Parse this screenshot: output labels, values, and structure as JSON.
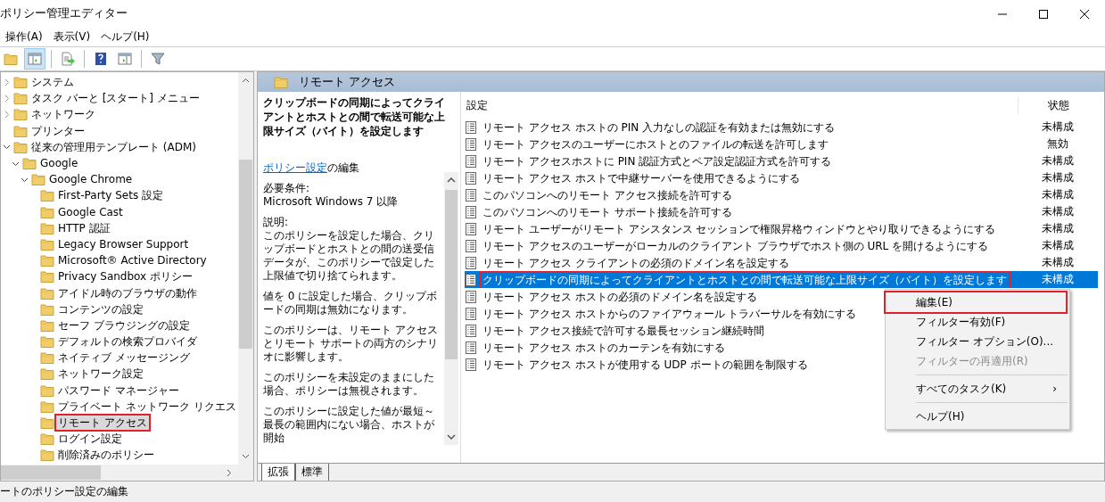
{
  "window": {
    "title": "ポリシー管理エディター"
  },
  "menu": [
    "操作(A)",
    "表示(V)",
    "ヘルプ(H)"
  ],
  "toolbar": [
    {
      "kind": "folder",
      "selected": false
    },
    {
      "kind": "pane",
      "selected": true
    },
    {
      "kind": "sep"
    },
    {
      "kind": "export",
      "selected": false
    },
    {
      "kind": "sep"
    },
    {
      "kind": "help",
      "selected": false
    },
    {
      "kind": "view",
      "selected": false
    },
    {
      "kind": "sep"
    },
    {
      "kind": "filter",
      "selected": false
    }
  ],
  "tree": [
    {
      "label": "システム",
      "expanded": false,
      "selected": false
    },
    {
      "label": "タスク バーと [スタート] メニュー",
      "expanded": false,
      "selected": false
    },
    {
      "label": "ネットワーク",
      "expanded": false,
      "selected": false
    },
    {
      "label": "プリンター",
      "selected": false
    },
    {
      "label": "従来の管理用テンプレート (ADM)",
      "expanded": true,
      "selected": false,
      "children": [
        {
          "label": "Google",
          "expanded": true,
          "selected": false,
          "children": [
            {
              "label": "Google Chrome",
              "expanded": true,
              "selected": false,
              "children": [
                {
                  "label": "First-Party Sets 設定",
                  "selected": false
                },
                {
                  "label": "Google Cast",
                  "selected": false
                },
                {
                  "label": "HTTP 認証",
                  "selected": false
                },
                {
                  "label": "Legacy Browser Support",
                  "selected": false
                },
                {
                  "label": "Microsoft® Active Directory",
                  "selected": false
                },
                {
                  "label": "Privacy Sandbox ポリシー",
                  "selected": false
                },
                {
                  "label": "アイドル時のブラウザの動作",
                  "selected": false
                },
                {
                  "label": "コンテンツの設定",
                  "selected": false
                },
                {
                  "label": "セーフ ブラウジングの設定",
                  "selected": false
                },
                {
                  "label": "デフォルトの検索プロバイダ",
                  "selected": false
                },
                {
                  "label": "ネイティブ メッセージング",
                  "selected": false
                },
                {
                  "label": "ネットワーク設定",
                  "selected": false
                },
                {
                  "label": "パスワード マネージャー",
                  "selected": false
                },
                {
                  "label": "プライベート ネットワーク リクエス",
                  "selected": false
                },
                {
                  "label": "リモート アクセス",
                  "selected": true,
                  "annotated": true
                },
                {
                  "label": "ログイン設定",
                  "selected": false
                },
                {
                  "label": "削除済みのポリシー",
                  "selected": false
                }
              ]
            }
          ]
        }
      ]
    }
  ],
  "header": {
    "title": "リモート アクセス"
  },
  "description": {
    "title": "クリップボードの同期によってクライアントとホストとの間で転送可能な上限サイズ（バイト）を設定します",
    "edit_link": "ポリシー設定",
    "edit_text": "の編集",
    "paragraphs": [
      "必要条件:\nMicrosoft Windows 7 以降",
      "説明:\nこのポリシーを設定した場合、クリップボードとホストとの間の送受信データが、このポリシーで設定した上限値で切り捨てられます。",
      "値を 0 に設定した場合、クリップボードの同期は無効になります。",
      "このポリシーは、リモート アクセスとリモート サポートの両方のシナリオに影響します。",
      "このポリシーを未設定のままにした場合、ポリシーは無視されます。",
      "このポリシーに設定した値が最短～最長の範囲内にない場合、ホストが開始"
    ]
  },
  "table": {
    "columns": [
      "設定",
      "状態"
    ],
    "rows": [
      {
        "setting": "リモート アクセス ホストの PIN 入力なしの認証を有効または無効にする",
        "state": "未構成",
        "selected": false
      },
      {
        "setting": "リモート アクセスのユーザーにホストとのファイルの転送を許可します",
        "state": "無効",
        "selected": false
      },
      {
        "setting": "リモート アクセスホストに PIN 認証方式とペア設定認証方式を許可する",
        "state": "未構成",
        "selected": false
      },
      {
        "setting": "リモート アクセス ホストで中継サーバーを使用できるようにする",
        "state": "未構成",
        "selected": false
      },
      {
        "setting": "このパソコンへのリモート アクセス接続を許可する",
        "state": "未構成",
        "selected": false
      },
      {
        "setting": "このパソコンへのリモート サポート接続を許可する",
        "state": "未構成",
        "selected": false
      },
      {
        "setting": "リモート ユーザーがリモート アシスタンス セッションで権限昇格ウィンドウとやり取りできるようにする",
        "state": "未構成",
        "selected": false
      },
      {
        "setting": "リモート アクセスのユーザーがローカルのクライアント ブラウザでホスト側の URL を開けるようにする",
        "state": "未構成",
        "selected": false
      },
      {
        "setting": "リモート アクセス クライアントの必須のドメイン名を設定する",
        "state": "未構成",
        "selected": false
      },
      {
        "setting": "クリップボードの同期によってクライアントとホストとの間で転送可能な上限サイズ（バイト）を設定します",
        "state": "未構成",
        "selected": true,
        "annotated": true
      },
      {
        "setting": "リモート アクセス ホストの必須のドメイン名を設定する",
        "state": "",
        "selected": false
      },
      {
        "setting": "リモート アクセス ホストからのファイアウォール トラバーサルを有効にする",
        "state": "",
        "selected": false
      },
      {
        "setting": "リモート アクセス接続で許可する最長セッション継続時間",
        "state": "",
        "selected": false
      },
      {
        "setting": "リモート アクセス ホストのカーテンを有効にする",
        "state": "",
        "selected": false
      },
      {
        "setting": "リモート アクセス ホストが使用する UDP ポートの範囲を制限する",
        "state": "",
        "selected": false
      }
    ]
  },
  "context_menu": [
    {
      "kind": "item",
      "label": "編集(E)",
      "disabled": false,
      "annotated": true
    },
    {
      "kind": "item",
      "label": "フィルター有効(F)",
      "disabled": false
    },
    {
      "kind": "item",
      "label": "フィルター オプション(O)...",
      "disabled": false
    },
    {
      "kind": "item",
      "label": "フィルターの再適用(R)",
      "disabled": true
    },
    {
      "kind": "separator"
    },
    {
      "kind": "submenu",
      "label": "すべてのタスク(K)",
      "arrow": "›",
      "disabled": false
    },
    {
      "kind": "separator"
    },
    {
      "kind": "item",
      "label": "ヘルプ(H)",
      "disabled": false
    }
  ],
  "tabs": [
    {
      "label": "拡張",
      "selected": true
    },
    {
      "label": "標準",
      "selected": false
    }
  ],
  "status_bar": "ートのポリシー設定の編集"
}
